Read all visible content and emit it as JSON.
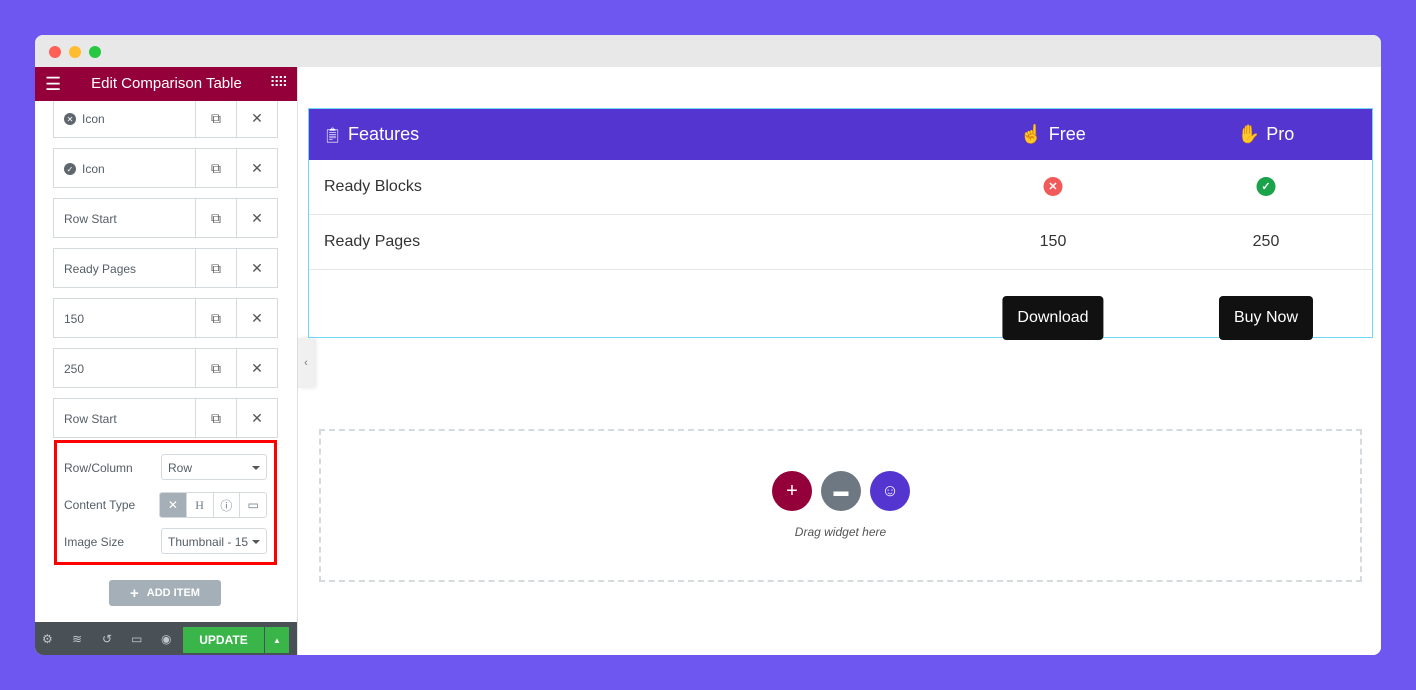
{
  "colors": {
    "background": "#6e56f0",
    "sidebar_header": "#93003a",
    "table_header": "#5535d0",
    "update": "#39b54a",
    "highlight": "#ff0000"
  },
  "sidebar": {
    "title": "Edit Comparison Table",
    "items": [
      {
        "label": "Icon",
        "icon": "times-circle-icon"
      },
      {
        "label": "Icon",
        "icon": "check-circle-icon"
      },
      {
        "label": "Row Start"
      },
      {
        "label": "Ready Pages"
      },
      {
        "label": "150"
      },
      {
        "label": "250"
      },
      {
        "label": "Row Start"
      }
    ],
    "panel": {
      "row_column_label": "Row/Column",
      "row_column_value": "Row",
      "content_type_label": "Content Type",
      "content_type_options": [
        "none",
        "heading",
        "icon",
        "image"
      ],
      "content_type_selected": "none",
      "image_size_label": "Image Size",
      "image_size_value": "Thumbnail - 15"
    },
    "add_item": "ADD ITEM",
    "update": "UPDATE"
  },
  "table": {
    "headers": [
      "Features",
      "Free",
      "Pro"
    ],
    "rows": [
      {
        "feature": "Ready Blocks",
        "free": "no",
        "pro": "yes"
      },
      {
        "feature": "Ready Pages",
        "free": "150",
        "pro": "250"
      }
    ],
    "buttons": [
      "Download",
      "Buy Now"
    ]
  },
  "dropzone": {
    "text": "Drag widget here"
  }
}
